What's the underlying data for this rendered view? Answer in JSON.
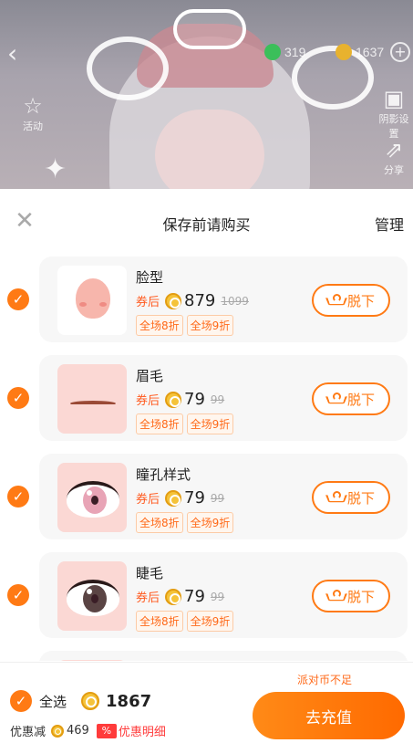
{
  "top": {
    "green_coin_balance": "319",
    "gold_coin_balance": "1637",
    "left_icon_label": "活动",
    "right_icons": [
      "阴影设置",
      "分享"
    ]
  },
  "sheet": {
    "title": "保存前请购买",
    "manage_label": "管理",
    "coupon_label": "券后",
    "remove_label": "脱下",
    "items": [
      {
        "name": "脸型",
        "price": "879",
        "original": "1099",
        "tags": [
          "全场8折",
          "全场9折"
        ],
        "selected": true
      },
      {
        "name": "眉毛",
        "price": "79",
        "original": "99",
        "tags": [
          "全场8折",
          "全场9折"
        ],
        "selected": true
      },
      {
        "name": "瞳孔样式",
        "price": "79",
        "original": "99",
        "tags": [
          "全场8折",
          "全场9折"
        ],
        "selected": true
      },
      {
        "name": "睫毛",
        "price": "79",
        "original": "99",
        "tags": [
          "全场8折",
          "全场9折"
        ],
        "selected": true
      }
    ]
  },
  "footer": {
    "select_all_label": "全选",
    "total": "1867",
    "discount_label": "优惠减",
    "discount_amount": "469",
    "discount_badge": "%",
    "discount_detail_label": "优惠明细",
    "shortfall_text": "派对币不足",
    "recharge_label": "去充值"
  },
  "colors": {
    "accent": "#ff7a14",
    "price_red": "#ff5a1f"
  }
}
